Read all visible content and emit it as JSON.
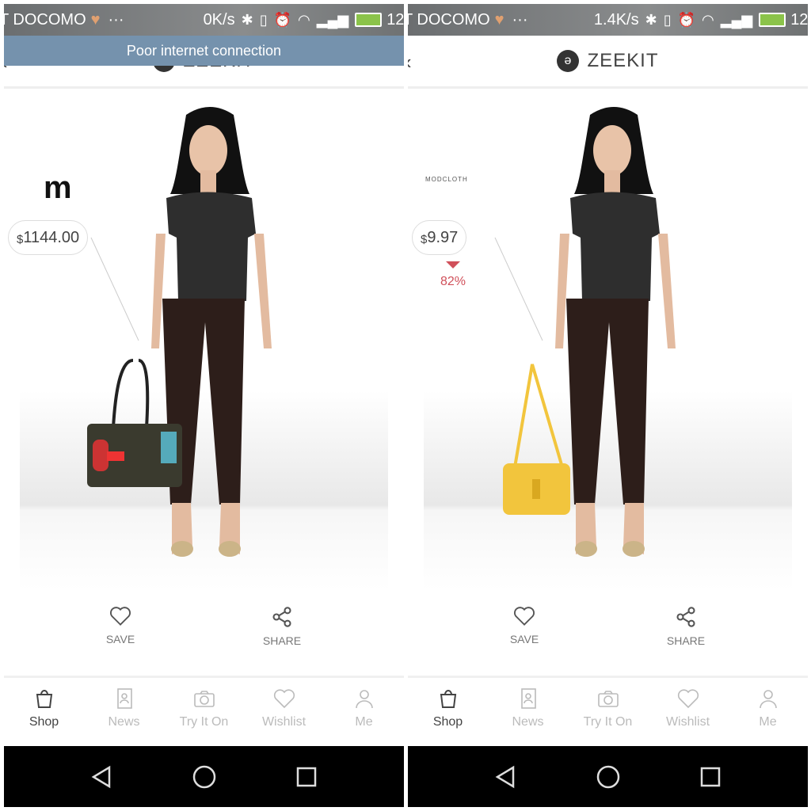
{
  "panels": [
    {
      "status": {
        "carrier": "T DOCOMO",
        "speed": "0K/s",
        "time": "12:"
      },
      "banner": "Poor internet connection",
      "header": {
        "logo": "ZEEKIT"
      },
      "product": {
        "brand_logo": "m",
        "currency": "$",
        "price": "1144.00",
        "bag_color": "#3a3a2e"
      },
      "actions": {
        "save": "SAVE",
        "share": "SHARE"
      },
      "nav": [
        "Shop",
        "News",
        "Try It On",
        "Wishlist",
        "Me"
      ]
    },
    {
      "status": {
        "carrier": "T DOCOMO",
        "speed": "1.4K/s",
        "time": "12:"
      },
      "header": {
        "logo": "ZEEKIT"
      },
      "product": {
        "brand": "MODCLOTH",
        "currency": "$",
        "price": "9.97",
        "discount": "82%",
        "bag_color": "#f2c53d"
      },
      "actions": {
        "save": "SAVE",
        "share": "SHARE"
      },
      "nav": [
        "Shop",
        "News",
        "Try It On",
        "Wishlist",
        "Me"
      ]
    }
  ],
  "colors": {
    "banner": "#7592ad",
    "discount": "#d0505a"
  }
}
